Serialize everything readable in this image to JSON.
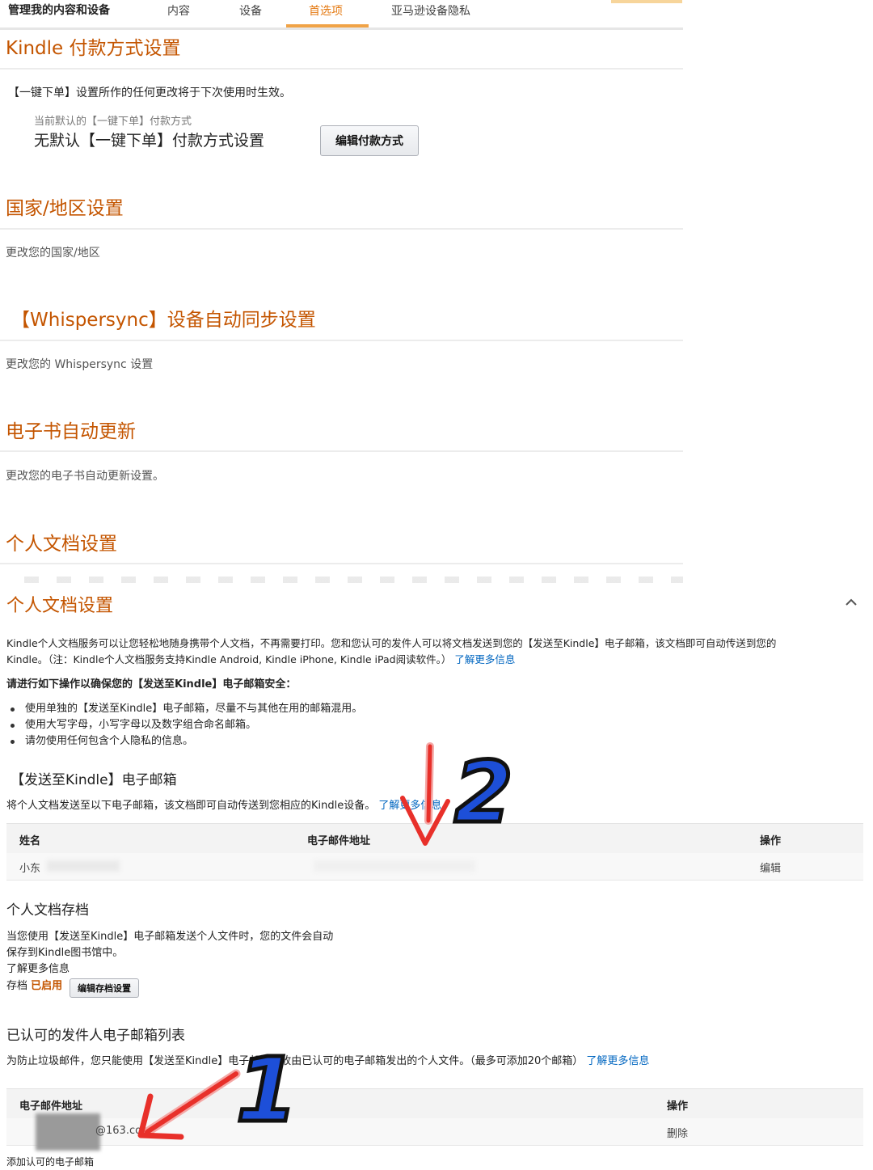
{
  "nav": {
    "brand": "管理我的内容和设备",
    "tabs": [
      {
        "label": "内容"
      },
      {
        "label": "设备"
      },
      {
        "label": "首选项",
        "active": true
      },
      {
        "label": "亚马逊设备隐私"
      }
    ]
  },
  "payment": {
    "title": "Kindle 付款方式设置",
    "note": "【一键下单】设置所作的任何更改将于下次使用时生效。",
    "current_label": "当前默认的【一键下单】付款方式",
    "current_value": "无默认【一键下单】付款方式设置",
    "edit_button": "编辑付款方式"
  },
  "region": {
    "title": "国家/地区设置",
    "desc": "更改您的国家/地区"
  },
  "whispersync": {
    "title": "【Whispersync】设备自动同步设置",
    "desc": "更改您的 Whispersync 设置"
  },
  "ebook": {
    "title": "电子书自动更新",
    "desc": "更改您的电子书自动更新设置。"
  },
  "personal_top": {
    "title": "个人文档设置"
  },
  "personal": {
    "title": "个人文档设置",
    "intro_line1": "Kindle个人文档服务可以让您轻松地随身携带个人文档，不再需要打印。您和您认可的发件人可以将文档发送到您的【发送至Kindle】电子邮箱，该文档即可自动传送到您的",
    "intro_line2": "Kindle。（注：Kindle个人文档服务支持Kindle Android, Kindle iPhone, Kindle iPad阅读软件。）",
    "intro_link": "了解更多信息",
    "security_title": "请进行如下操作以确保您的【发送至Kindle】电子邮箱安全：",
    "bullets": [
      "使用单独的【发送至Kindle】电子邮箱，尽量不与其他在用的邮箱混用。",
      "使用大写字母，小写字母以及数字组合命名邮箱。",
      "请勿使用任何包含个人隐私的信息。"
    ]
  },
  "send_to_kindle": {
    "title": "【发送至Kindle】电子邮箱",
    "desc": "将个人文档发送至以下电子邮箱，该文档即可自动传送到您相应的Kindle设备。",
    "link": "了解更多信息",
    "headers": {
      "name": "姓名",
      "email": "电子邮件地址",
      "action": "操作"
    },
    "row": {
      "name": "小东",
      "action": "编辑"
    }
  },
  "archive": {
    "title": "个人文档存档",
    "desc_line1": "当您使用【发送至Kindle】电子邮箱发送个人文件时，您的文件会自动",
    "desc_line2": "保存到Kindle图书馆中。",
    "link": "了解更多信息",
    "status_label": "存档",
    "status_value": "已启用",
    "edit_button": "编辑存档设置"
  },
  "approved": {
    "title": "已认可的发件人电子邮箱列表",
    "desc": "为防止垃圾邮件，您只能使用【发送至Kindle】电子邮箱接收由已认可的电子邮箱发出的个人文件。（最多可添加20个邮箱）",
    "link": "了解更多信息",
    "headers": {
      "email": "电子邮件地址",
      "action": "操作"
    },
    "row": {
      "email_partial": "@163.com",
      "action": "删除"
    },
    "add_link": "添加认可的电子邮箱"
  },
  "annotations": {
    "arrow1_number": "1",
    "arrow2_number": "2"
  },
  "colors": {
    "heading": "#c45500",
    "link": "#0066c0",
    "active_tab": "#e47911",
    "arrow_red": "#e8302a",
    "badge_blue": "#1d4fd8"
  }
}
